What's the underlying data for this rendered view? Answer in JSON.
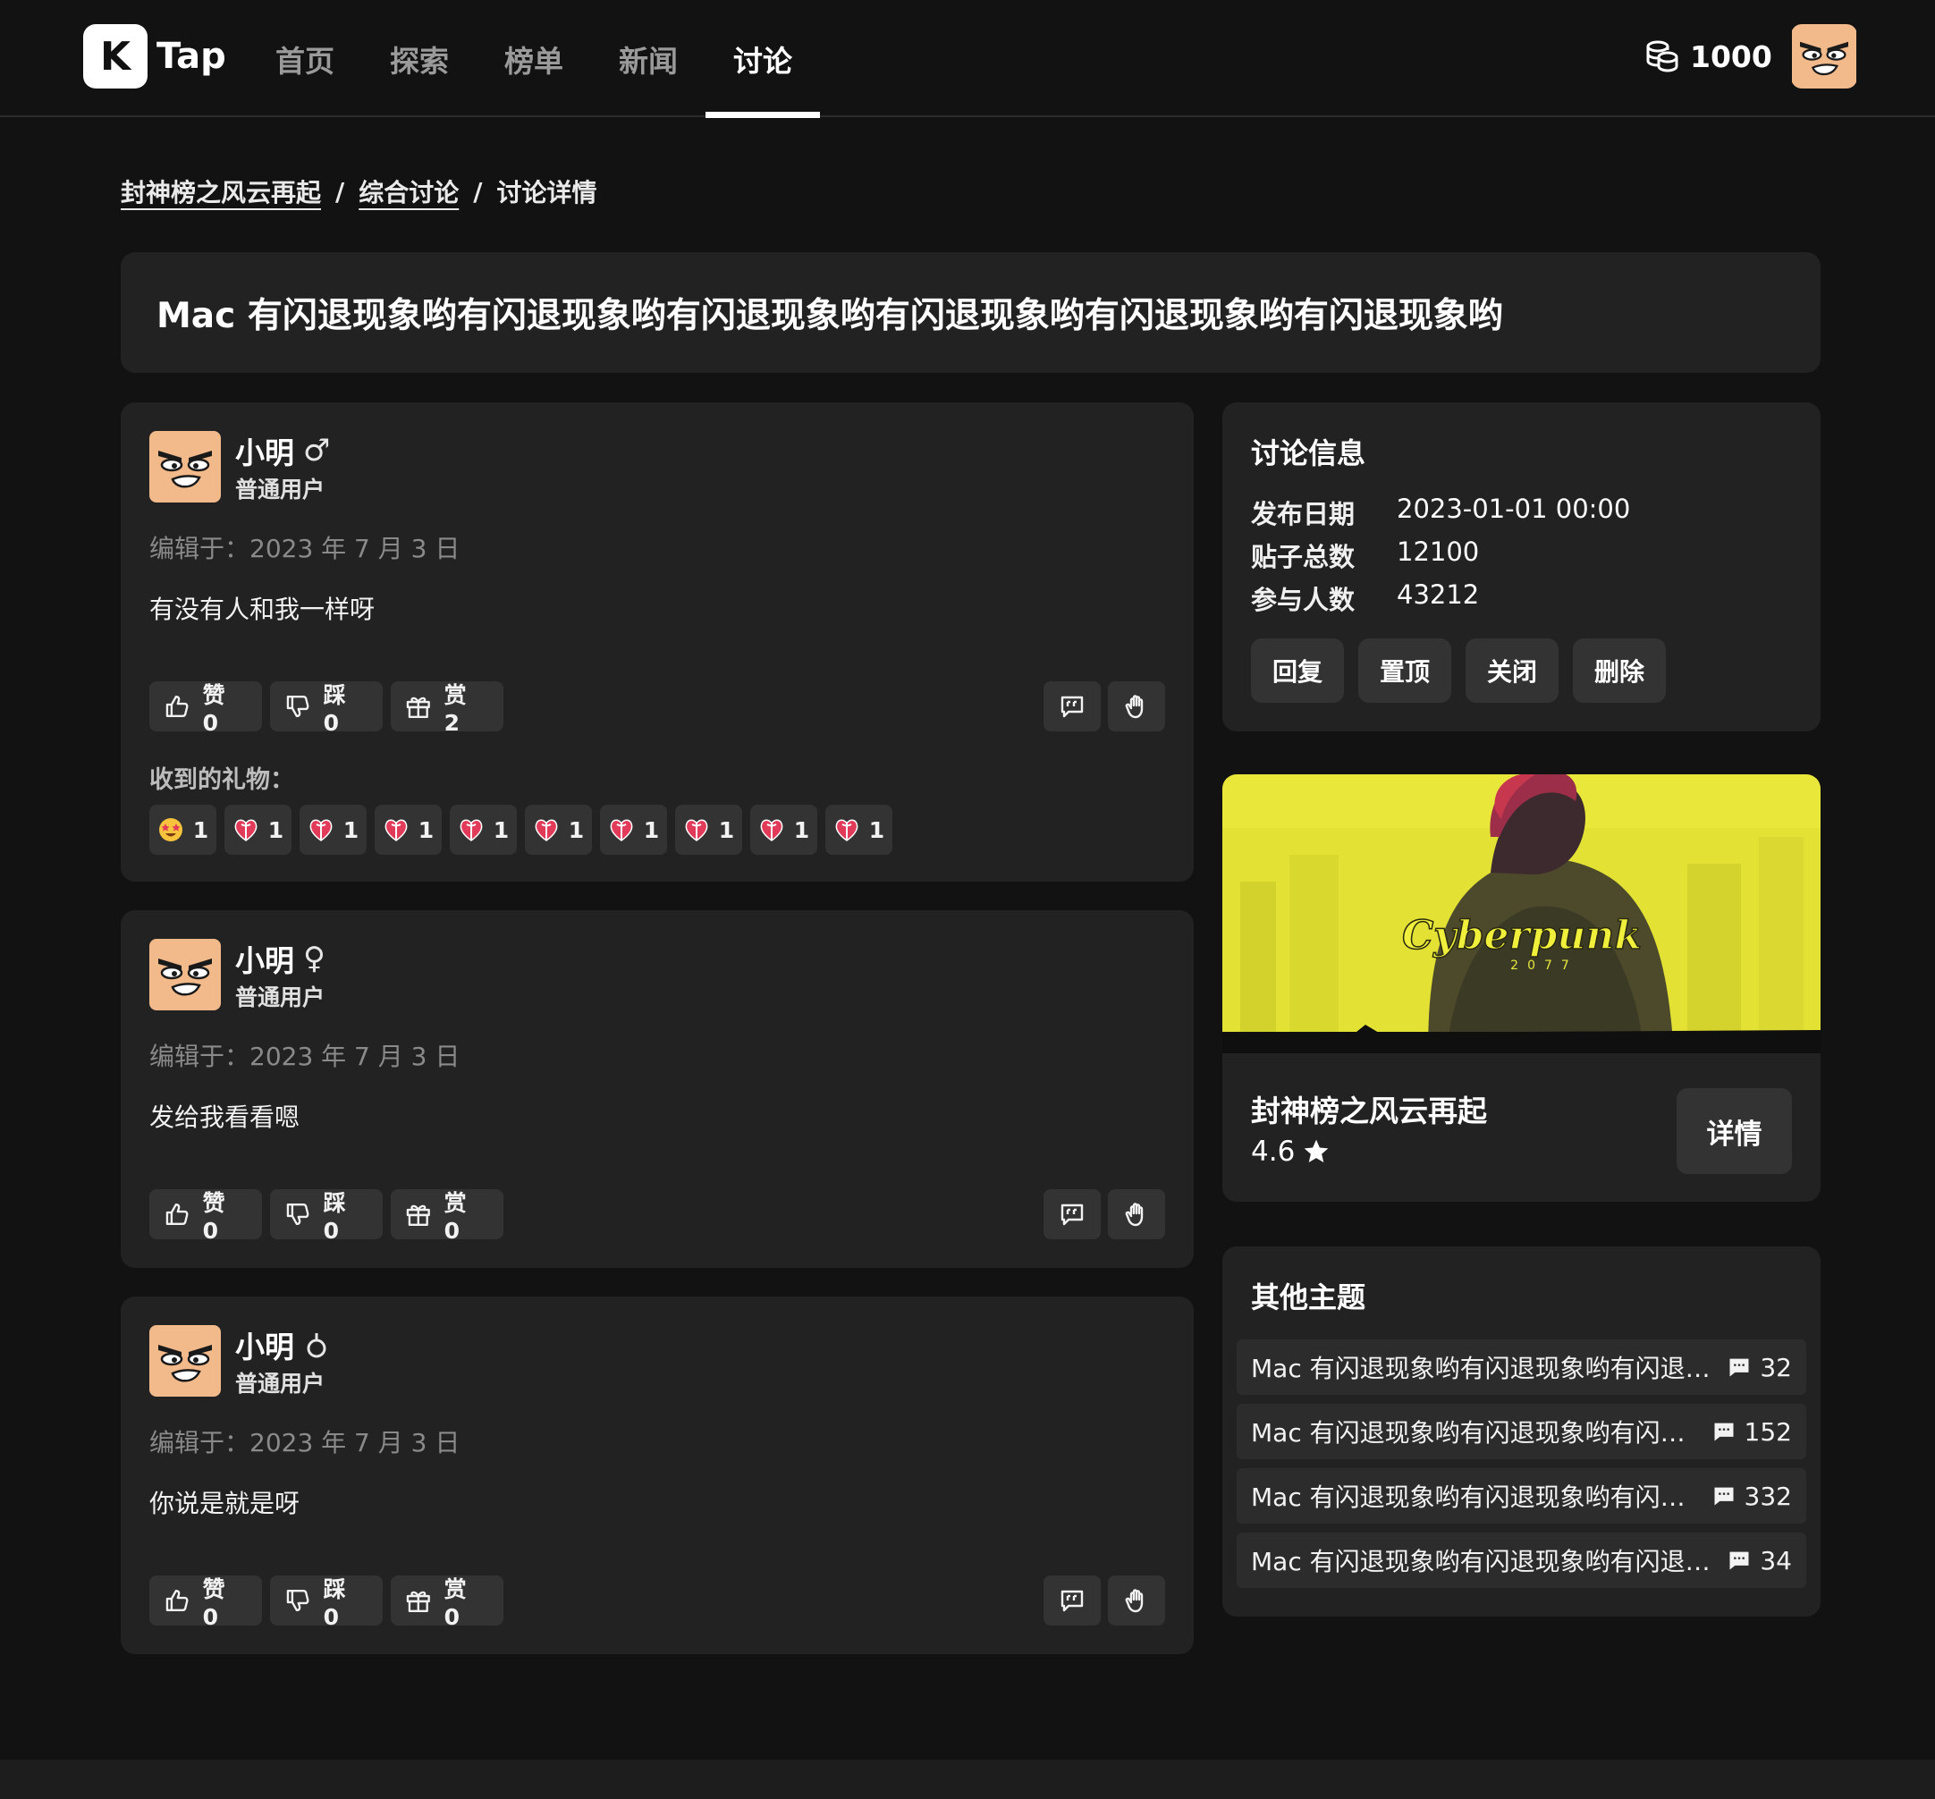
{
  "header": {
    "logo_letter": "K",
    "logo_text": "Tap",
    "nav": [
      "首页",
      "探索",
      "榜单",
      "新闻",
      "讨论"
    ],
    "active_nav": "讨论",
    "coins": "1000"
  },
  "breadcrumb": [
    "封神榜之风云再起",
    "综合讨论",
    "讨论详情"
  ],
  "breadcrumb_separator": "/",
  "title": "Mac 有闪退现象哟有闪退现象哟有闪退现象哟有闪退现象哟有闪退现象哟有闪退现象哟",
  "posts": [
    {
      "name": "小明",
      "gender": "♂",
      "role": "普通用户",
      "edited": "编辑于：2023 年 7 月 3 日",
      "body": "有没有人和我一样呀",
      "like": "赞 0",
      "dislike": "踩 0",
      "reward": "赏 2",
      "gifts_label": "收到的礼物：",
      "gifts": [
        {
          "icon": "star-struck-emoji",
          "count": "1"
        },
        {
          "icon": "gift-heart",
          "count": "1"
        },
        {
          "icon": "gift-heart",
          "count": "1"
        },
        {
          "icon": "gift-heart",
          "count": "1"
        },
        {
          "icon": "gift-heart",
          "count": "1"
        },
        {
          "icon": "gift-heart",
          "count": "1"
        },
        {
          "icon": "gift-heart",
          "count": "1"
        },
        {
          "icon": "gift-heart",
          "count": "1"
        },
        {
          "icon": "gift-heart",
          "count": "1"
        },
        {
          "icon": "gift-heart",
          "count": "1"
        }
      ]
    },
    {
      "name": "小明",
      "gender": "♀",
      "role": "普通用户",
      "edited": "编辑于：2023 年 7 月 3 日",
      "body": "发给我看看嗯",
      "like": "赞 0",
      "dislike": "踩 0",
      "reward": "赏 0"
    },
    {
      "name": "小明",
      "gender": "neutral",
      "role": "普通用户",
      "edited": "编辑于：2023 年 7 月 3 日",
      "body": "你说是就是呀",
      "like": "赞 0",
      "dislike": "踩 0",
      "reward": "赏 0"
    }
  ],
  "discussion_info": {
    "title": "讨论信息",
    "rows": [
      {
        "label": "发布日期",
        "value": "2023-01-01 00:00"
      },
      {
        "label": "贴子总数",
        "value": "12100"
      },
      {
        "label": "参与人数",
        "value": "43212"
      }
    ],
    "buttons": [
      "回复",
      "置顶",
      "关闭",
      "删除"
    ]
  },
  "game": {
    "banner_text": "Cyberpunk",
    "banner_sub": "2077",
    "name": "封神榜之风云再起",
    "rating": "4.6",
    "detail_button": "详情"
  },
  "other_topics": {
    "title": "其他主题",
    "items": [
      {
        "title": "Mac 有闪退现象哟有闪退现象哟有闪退…",
        "count": "32"
      },
      {
        "title": "Mac 有闪退现象哟有闪退现象哟有闪…",
        "count": "152"
      },
      {
        "title": "Mac 有闪退现象哟有闪退现象哟有闪…",
        "count": "332"
      },
      {
        "title": "Mac 有闪退现象哟有闪退现象哟有闪退…",
        "count": "34"
      }
    ]
  },
  "colors": {
    "background": "#121212",
    "card": "#222222",
    "button": "#333333",
    "accent": "#ffffff",
    "gift_heart": "#e23b5a",
    "banner_yellow": "#e9e83a"
  }
}
